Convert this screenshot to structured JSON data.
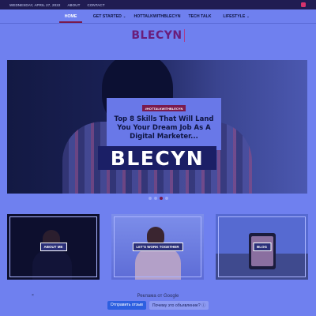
{
  "topbar": {
    "date": "WEDNESDAY, APRIL 27, 2022",
    "about": "ABOUT",
    "contact": "CONTACT"
  },
  "nav": {
    "home": "HOME",
    "get_started": "GET STARTED",
    "hot_talk": "HOTTALKWITHBLECYN",
    "tech_talk": "TECH TALK",
    "lifestyle": "LIFESTYLE",
    "caret": "⌄"
  },
  "logo": {
    "text": "BLECYN"
  },
  "hero": {
    "tag": "#HOTTALKWITHBLECYN",
    "title": "Top 8 Skills That Will Land You Your Dream Job As A Digital Marketer...",
    "watermark": "BLECYN",
    "active_slide": 3,
    "slide_count": 4
  },
  "cards": [
    {
      "label": "ABOUT ME"
    },
    {
      "label": "LET'S WORK TOGETHER"
    },
    {
      "label": "BLOG"
    }
  ],
  "ad": {
    "label": "Реклама от Google",
    "close": "×",
    "send_feedback": "Отправить отзыв",
    "why_ad": "Почему это объявление? ⓘ"
  },
  "colors": {
    "accent": "#7a1a4c",
    "background": "#6f80ef",
    "topbar": "#201c52"
  }
}
